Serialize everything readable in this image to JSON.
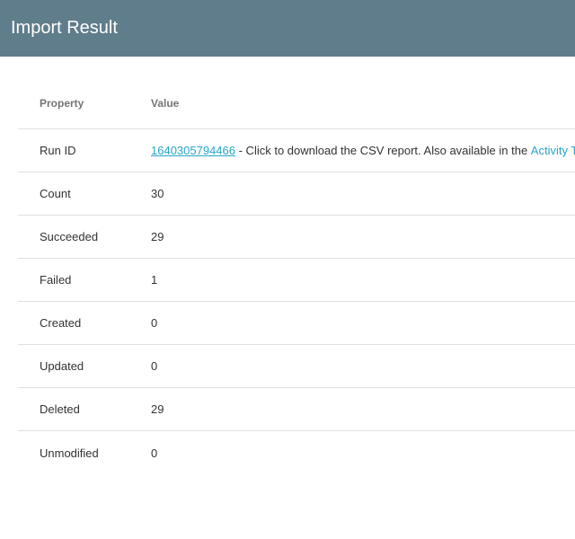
{
  "header": {
    "title": "Import Result"
  },
  "table": {
    "columns": {
      "property": "Property",
      "value": "Value"
    },
    "run": {
      "label": "Run ID",
      "id": "1640305794466",
      "text": " - Click to download the CSV report. Also available in the ",
      "link": "Activity T"
    },
    "rows": [
      {
        "label": "Count",
        "value": "30"
      },
      {
        "label": "Succeeded",
        "value": "29"
      },
      {
        "label": "Failed",
        "value": "1"
      },
      {
        "label": "Created",
        "value": "0"
      },
      {
        "label": "Updated",
        "value": "0"
      },
      {
        "label": "Deleted",
        "value": "29"
      },
      {
        "label": "Unmodified",
        "value": "0"
      }
    ]
  }
}
